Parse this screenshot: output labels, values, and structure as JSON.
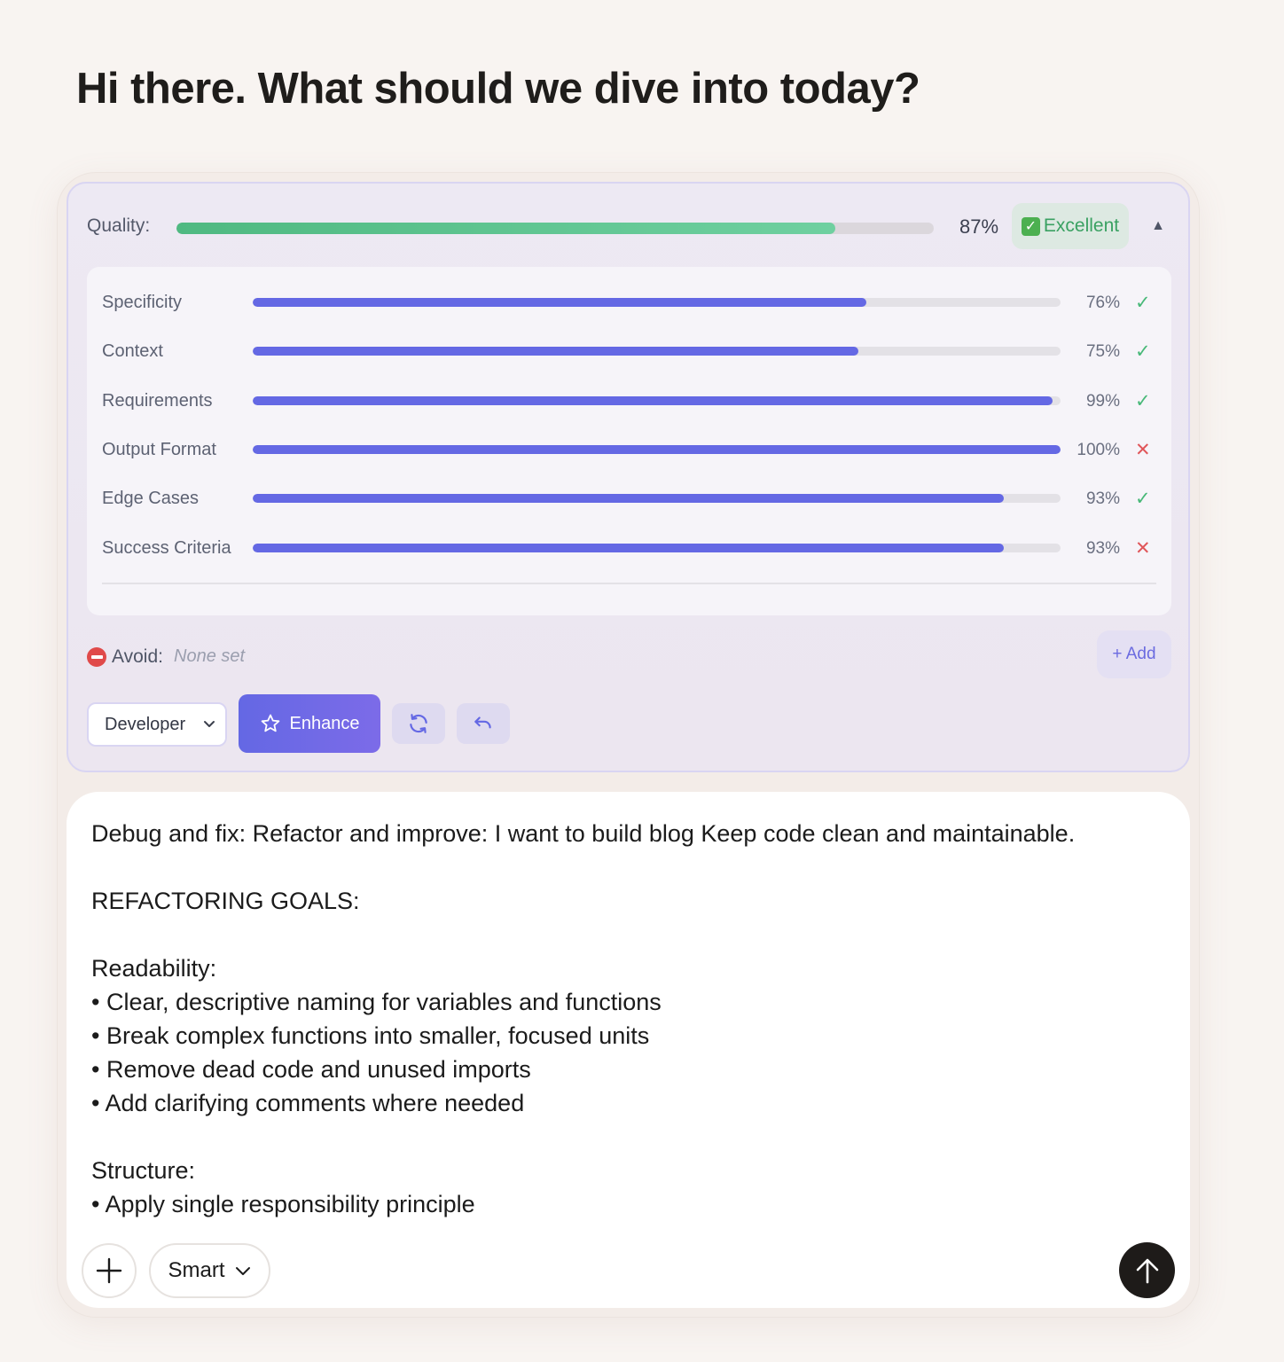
{
  "page": {
    "title": "Hi there. What should we dive into today?"
  },
  "quality": {
    "label": "Quality:",
    "value": 87,
    "percent_text": "87%",
    "badge_label": "Excellent",
    "collapse_glyph": "▲",
    "colors": {
      "overall_bar": "#4fb981",
      "metric_bar": "#6468e4",
      "pass": "#48b878",
      "fail": "#e0565a"
    }
  },
  "metrics": [
    {
      "label": "Specificity",
      "value": 76,
      "percent_text": "76%",
      "status": "pass",
      "status_glyph": "✓"
    },
    {
      "label": "Context",
      "value": 75,
      "percent_text": "75%",
      "status": "pass",
      "status_glyph": "✓"
    },
    {
      "label": "Requirements",
      "value": 99,
      "percent_text": "99%",
      "status": "pass",
      "status_glyph": "✓"
    },
    {
      "label": "Output Format",
      "value": 100,
      "percent_text": "100%",
      "status": "fail",
      "status_glyph": "✕"
    },
    {
      "label": "Edge Cases",
      "value": 93,
      "percent_text": "93%",
      "status": "pass",
      "status_glyph": "✓"
    },
    {
      "label": "Success Criteria",
      "value": 93,
      "percent_text": "93%",
      "status": "fail",
      "status_glyph": "✕"
    }
  ],
  "avoid": {
    "label": "Avoid:",
    "value": "None set",
    "add_label": "+ Add"
  },
  "controls": {
    "role_selected": "Developer",
    "enhance_label": "Enhance",
    "refresh_icon": "refresh-icon",
    "undo_icon": "undo-icon"
  },
  "prompt": {
    "text": "Debug and fix: Refactor and improve: I want to build blog Keep code clean and maintainable.\n\nREFACTORING GOALS:\n\nReadability:\n• Clear, descriptive naming for variables and functions\n• Break complex functions into smaller, focused units\n• Remove dead code and unused imports\n• Add clarifying comments where needed\n\nStructure:\n• Apply single responsibility principle"
  },
  "composer": {
    "mode_label": "Smart"
  }
}
